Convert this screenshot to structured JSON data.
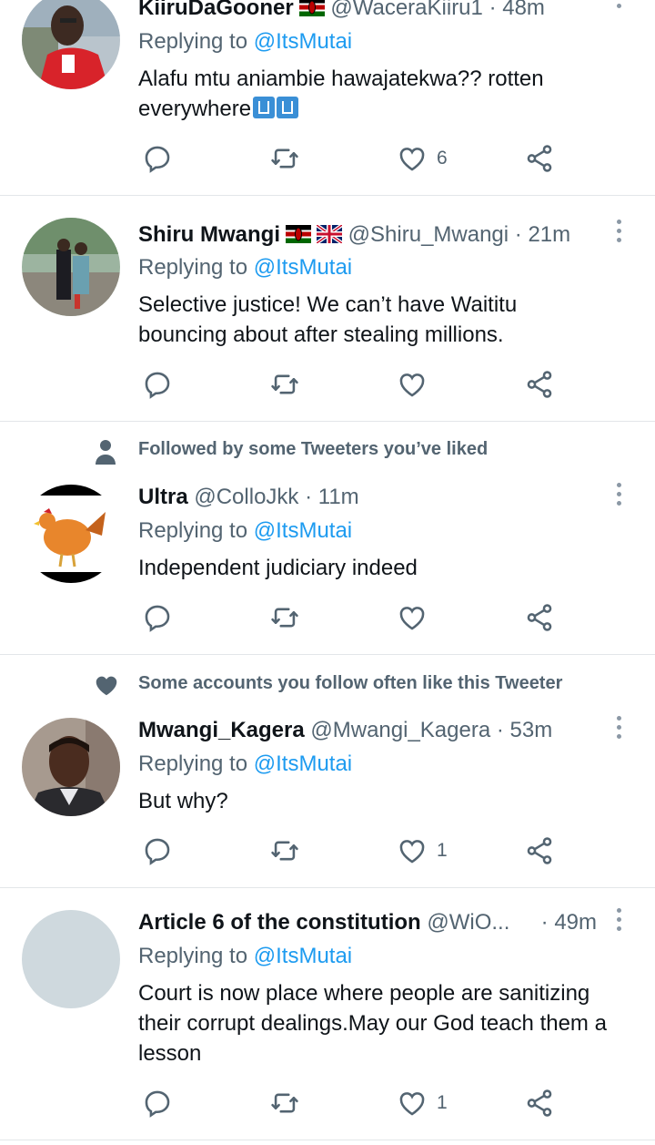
{
  "tweets": [
    {
      "name": "KiiruDaGooner",
      "flags": [
        "kenya"
      ],
      "handle": "@WaceraKiiru1",
      "dot": "·",
      "time": "48m",
      "replying_prefix": "Replying to",
      "replying_to": "@ItsMutai",
      "text_lines": [
        "Alafu mtu aniambie hawajatekwa?? rotten",
        "everywhere"
      ],
      "emojis": [
        "put-litter-in-its-place",
        "put-litter-in-its-place"
      ],
      "likes": "6"
    },
    {
      "name": "Shiru Mwangi",
      "flags": [
        "kenya",
        "uk"
      ],
      "handle": "@Shiru_Mwangi",
      "dot": "·",
      "time": "21m",
      "replying_prefix": "Replying to",
      "replying_to": "@ItsMutai",
      "text_lines": [
        "Selective justice! We can’t have Waititu",
        "bouncing about after stealing millions."
      ],
      "likes": ""
    },
    {
      "social_context": "Followed by some Tweeters you’ve liked",
      "social_icon": "person-icon",
      "name": "Ultra",
      "handle": "@ColloJkk",
      "dot": "·",
      "time": "11m",
      "replying_prefix": "Replying to",
      "replying_to": "@ItsMutai",
      "text_lines": [
        "Independent judiciary indeed"
      ],
      "likes": ""
    },
    {
      "social_context": "Some accounts you follow often like this Tweeter",
      "social_icon": "heart-filled-icon",
      "name": "Mwangi_Kagera",
      "handle": "@Mwangi_Kagera",
      "dot": "·",
      "time": "53m",
      "replying_prefix": "Replying to",
      "replying_to": "@ItsMutai",
      "text_lines": [
        "But why?"
      ],
      "likes": "1"
    },
    {
      "name": "Article 6 of the constitution",
      "handle": "@WiO...",
      "dot": "·",
      "time": "49m",
      "replying_prefix": "Replying to",
      "replying_to": "@ItsMutai",
      "text_lines": [
        "Court is now place where people are sanitizing",
        "their corrupt dealings.May our God teach them a",
        "lesson"
      ],
      "likes": "1"
    }
  ],
  "colors": {
    "accent": "#1d9bf0",
    "muted": "#536471",
    "divider": "#e3e6e9",
    "text": "#0f1419"
  }
}
